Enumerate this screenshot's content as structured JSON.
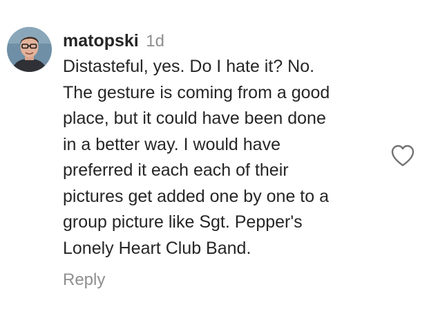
{
  "comment": {
    "username": "matopski",
    "timestamp": "1d",
    "body_lines": [
      "Distasteful, yes. Do I hate it? No.",
      "The gesture is coming from a good",
      "place, but it could have been done",
      "in a better way. I would have",
      "preferred it each each of their",
      "pictures get added one by one to a",
      "group picture like Sgt. Pepper's",
      "Lonely Heart Club Band."
    ],
    "reply_label": "Reply",
    "like_icon": "heart-outline-icon",
    "avatar_icon": "user-avatar-photo"
  },
  "colors": {
    "text": "#262626",
    "secondary_text": "#8e8e8e",
    "background": "#ffffff"
  }
}
